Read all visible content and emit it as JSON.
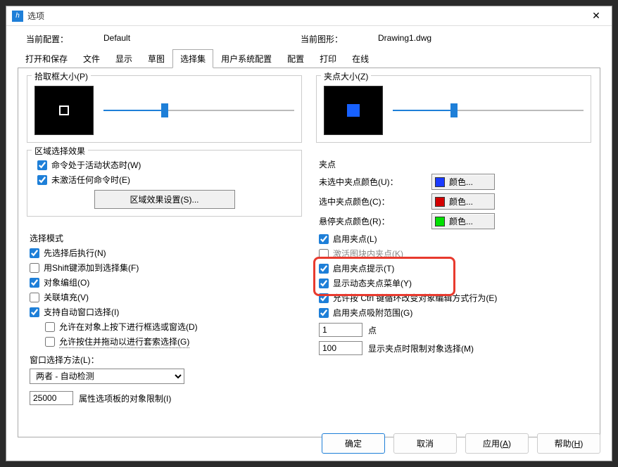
{
  "titlebar": {
    "title": "选项"
  },
  "info": {
    "current_config_label": "当前配置：",
    "current_config_value": "Default",
    "current_drawing_label": "当前图形：",
    "current_drawing_value": "Drawing1.dwg"
  },
  "tabs": [
    "打开和保存",
    "文件",
    "显示",
    "草图",
    "选择集",
    "用户系统配置",
    "配置",
    "打印",
    "在线"
  ],
  "active_tab": "选择集",
  "left": {
    "pickbox_title": "拾取框大小(P)",
    "pickbox_slider_pct": 32,
    "region_title": "区域选择效果",
    "region_chk_active": "命令处于活动状态时(W)",
    "region_chk_noactive": "未激活任何命令时(E)",
    "region_settings_btn": "区域效果设置(S)...",
    "selmode_title": "选择模式",
    "selmode_preselect": "先选择后执行(N)",
    "selmode_shift": "用Shift键添加到选择集(F)",
    "selmode_group": "对象编组(O)",
    "selmode_hatch": "关联填充(V)",
    "selmode_implied": "支持自动窗口选择(I)",
    "selmode_sub1": "允许在对象上按下进行框选或窗选(D)",
    "selmode_sub2": "允许按住并拖动以进行套索选择(G)",
    "winsel_label": "窗口选择方法(L)：",
    "winsel_value": "两者 - 自动检测",
    "prop_limit_value": "25000",
    "prop_limit_label": "属性选项板的对象限制(I)"
  },
  "right": {
    "gripsize_title": "夹点大小(Z)",
    "gripsize_slider_pct": 32,
    "grips_title": "夹点",
    "color_unsel_label": "未选中夹点颜色(U)：",
    "color_sel_label": "选中夹点颜色(C)：",
    "color_hover_label": "悬停夹点颜色(R)：",
    "color_btn_label": "颜色...",
    "color_unsel_hex": "#1a3aff",
    "color_sel_hex": "#d40000",
    "color_hover_hex": "#00e000",
    "chk_enable_grips": "启用夹点(L)",
    "chk_block_grips": "激活图块内夹点(K)",
    "chk_grip_tips": "启用夹点提示(T)",
    "chk_dyn_menu": "显示动态夹点菜单(Y)",
    "chk_ctrl_cycle": "允许按 Ctrl 键循环改变对象编辑方式行为(E)",
    "chk_snap_range": "启用夹点吸附范围(G)",
    "num_points_value": "1",
    "num_points_label": "点",
    "num_limit_value": "100",
    "num_limit_label": "显示夹点时限制对象选择(M)"
  },
  "buttons": {
    "ok": "确定",
    "cancel": "取消",
    "apply": "应用(A)",
    "help": "帮助(H)"
  }
}
